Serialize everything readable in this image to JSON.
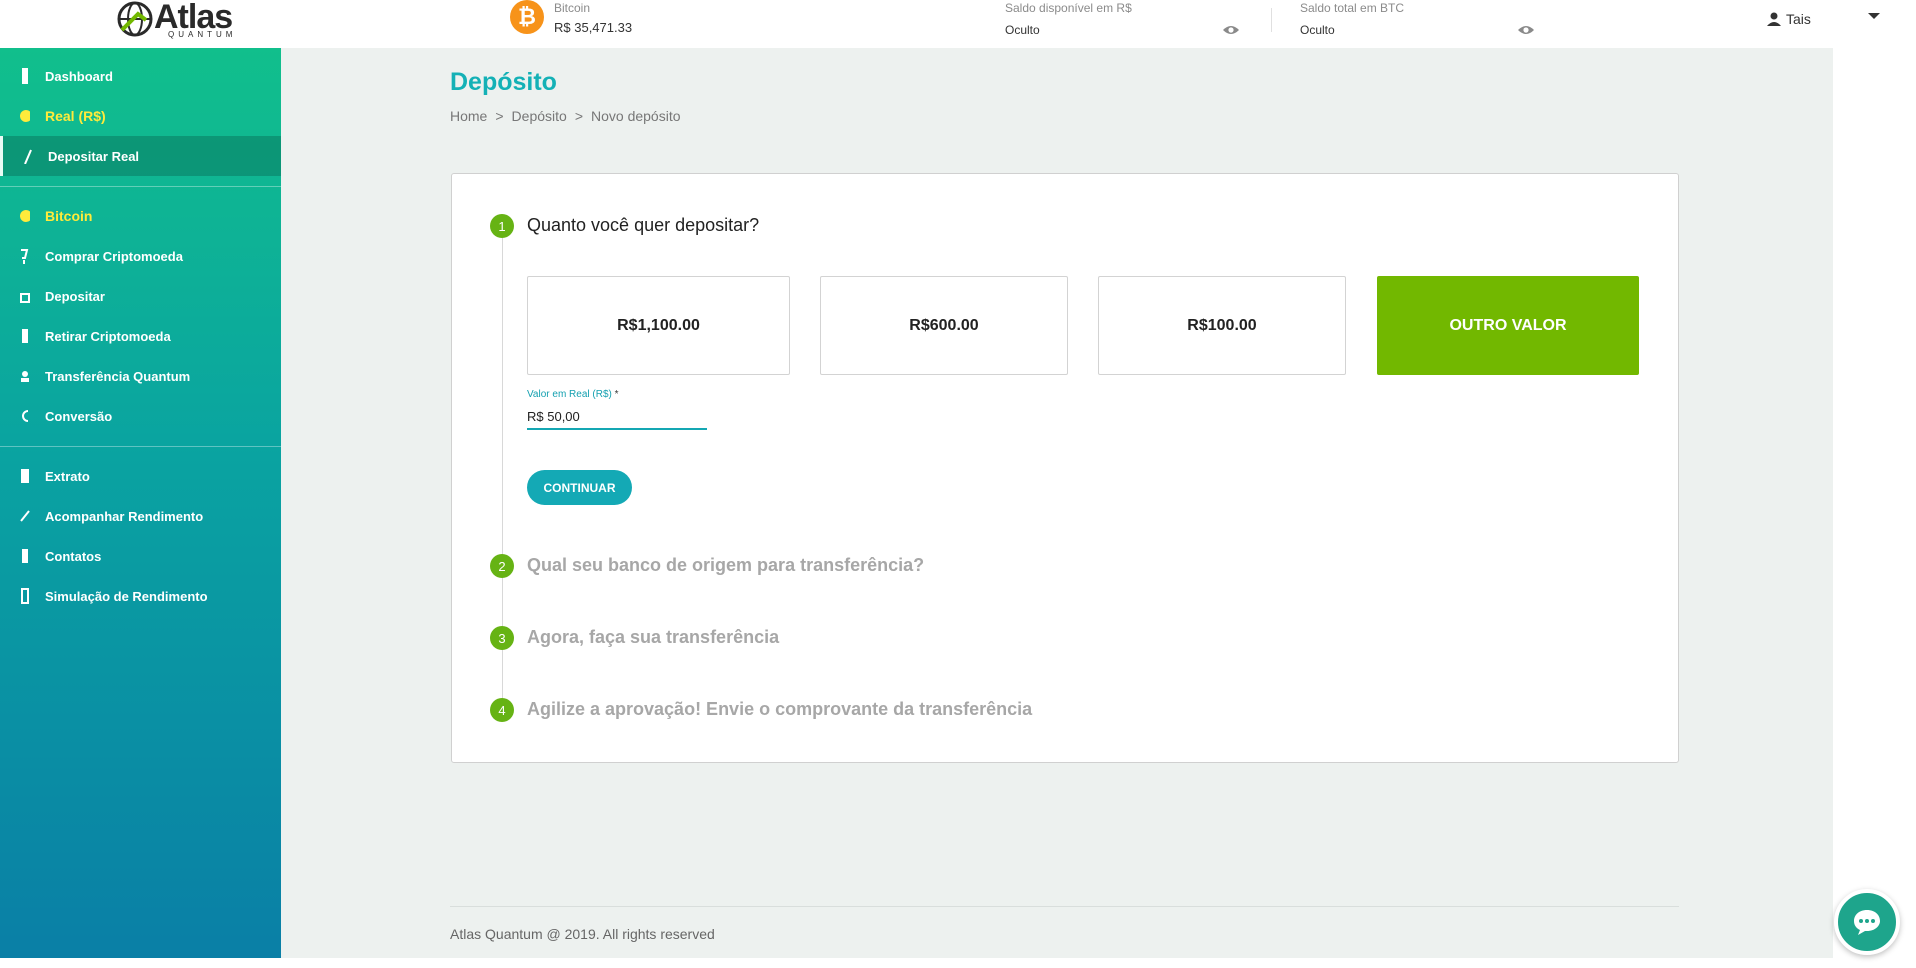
{
  "header": {
    "logo_text": "Atlas",
    "logo_sub": "QUANTUM",
    "btc_symbol": "₿",
    "bitcoin_label": "Bitcoin",
    "bitcoin_value": "R$ 35,471.33",
    "available_label": "Saldo disponível em R$",
    "available_value": "Oculto",
    "total_label": "Saldo total em BTC",
    "total_value": "Oculto",
    "user_name": "Tais"
  },
  "sidebar": {
    "items": [
      {
        "label": "Dashboard"
      },
      {
        "label": "Real (R$)"
      },
      {
        "label": "Depositar Real"
      },
      {
        "label": "Bitcoin"
      },
      {
        "label": "Comprar Criptomoeda"
      },
      {
        "label": "Depositar"
      },
      {
        "label": "Retirar Criptomoeda"
      },
      {
        "label": "Transferência Quantum"
      },
      {
        "label": "Conversão"
      },
      {
        "label": "Extrato"
      },
      {
        "label": "Acompanhar Rendimento"
      },
      {
        "label": "Contatos"
      },
      {
        "label": "Simulação de Rendimento"
      }
    ]
  },
  "page": {
    "title": "Depósito",
    "breadcrumb": [
      "Home",
      ">",
      "Depósito",
      ">",
      "Novo depósito"
    ]
  },
  "steps": [
    {
      "number": "1",
      "title": "Quanto você quer depositar?"
    },
    {
      "number": "2",
      "title": "Qual seu banco de origem para transferência?"
    },
    {
      "number": "3",
      "title": "Agora, faça sua transferência"
    },
    {
      "number": "4",
      "title": "Agilize a aprovação! Envie o comprovante da transferência"
    }
  ],
  "amounts": [
    "R$1,100.00",
    "R$600.00",
    "R$100.00",
    "OUTRO VALOR"
  ],
  "field": {
    "label": "Valor em Real (R$)",
    "required_mark": "*",
    "value": "R$ 50,00"
  },
  "continue_label": "CONTINUAR",
  "footer": "Atlas Quantum @ 2019. All rights reserved",
  "colors": {
    "accent": "#14b1b6",
    "green": "#72b800",
    "bitcoin": "#f7931a",
    "section_label": "#ffeb3b"
  }
}
